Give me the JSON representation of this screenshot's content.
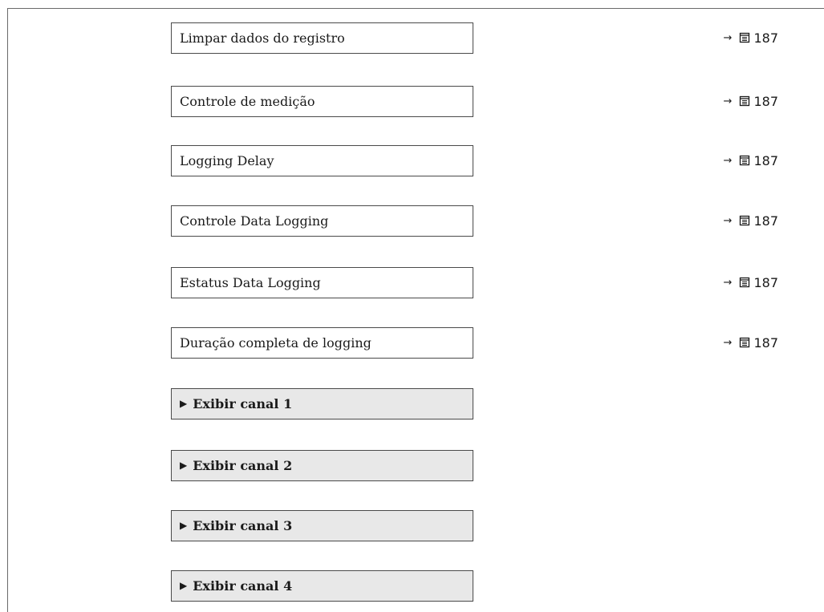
{
  "items": [
    {
      "label": "Limpar dados do registro",
      "page": "187"
    },
    {
      "label": "Controle de medição",
      "page": "187"
    },
    {
      "label": "Logging Delay",
      "page": "187"
    },
    {
      "label": "Controle Data Logging",
      "page": "187"
    },
    {
      "label": "Estatus Data Logging",
      "page": "187"
    },
    {
      "label": "Duração completa de logging",
      "page": "187"
    }
  ],
  "submenus": [
    {
      "label": "Exibir canal 1"
    },
    {
      "label": "Exibir canal 2"
    },
    {
      "label": "Exibir canal 3"
    },
    {
      "label": "Exibir canal 4"
    }
  ],
  "icons": {
    "arrow": "→",
    "submenu_marker": "▶",
    "book": "page-reference-book-icon"
  }
}
